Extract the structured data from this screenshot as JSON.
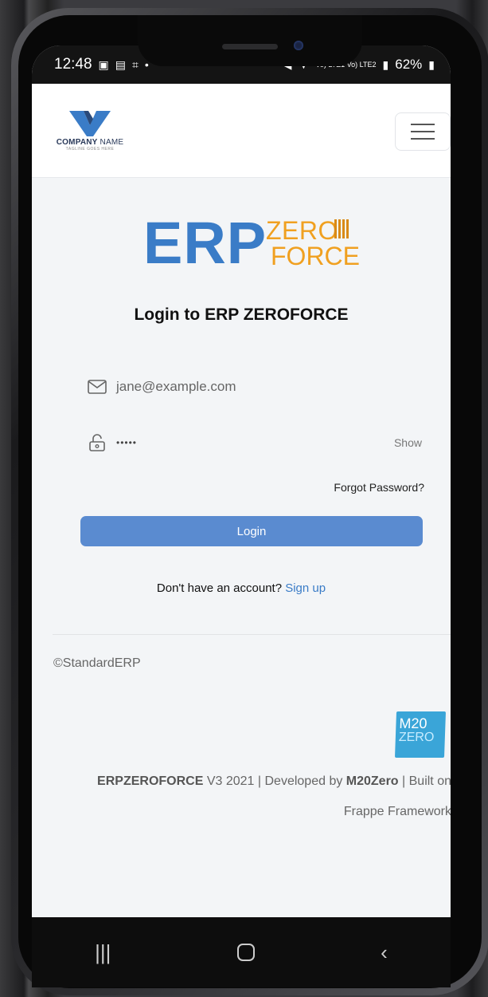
{
  "status_bar": {
    "time": "12:48",
    "network": "Vo) LTE1 Vo) LTE2",
    "battery": "62%"
  },
  "navbar": {
    "company_name_bold": "COMPANY",
    "company_name_rest": " NAME",
    "tagline": "TAGLINE GOES HERE"
  },
  "brand": {
    "erp": "ERP",
    "zero": "ZERO",
    "force": "FORCE"
  },
  "login": {
    "title": "Login to ERP ZEROFORCE",
    "email_value": "jane@example.com",
    "password_dots": "•••••",
    "show_label": "Show",
    "forgot_label": "Forgot Password?",
    "login_button": "Login",
    "no_account_text": "Don't have an account? ",
    "signup_link": "Sign up"
  },
  "footer": {
    "copyright": "©StandardERP",
    "m20_logo_line1": "M20",
    "m20_logo_line2": "ZERO",
    "product": "ERPZEROFORCE",
    "version_text": " V3 2021 | Developed by ",
    "developer": "M20Zero",
    "built_on_text": " | Built on",
    "framework": "Frappe Framework"
  },
  "colors": {
    "brand_blue": "#3a7cc7",
    "brand_orange": "#f0a020",
    "button_blue": "#5a8bd0"
  }
}
